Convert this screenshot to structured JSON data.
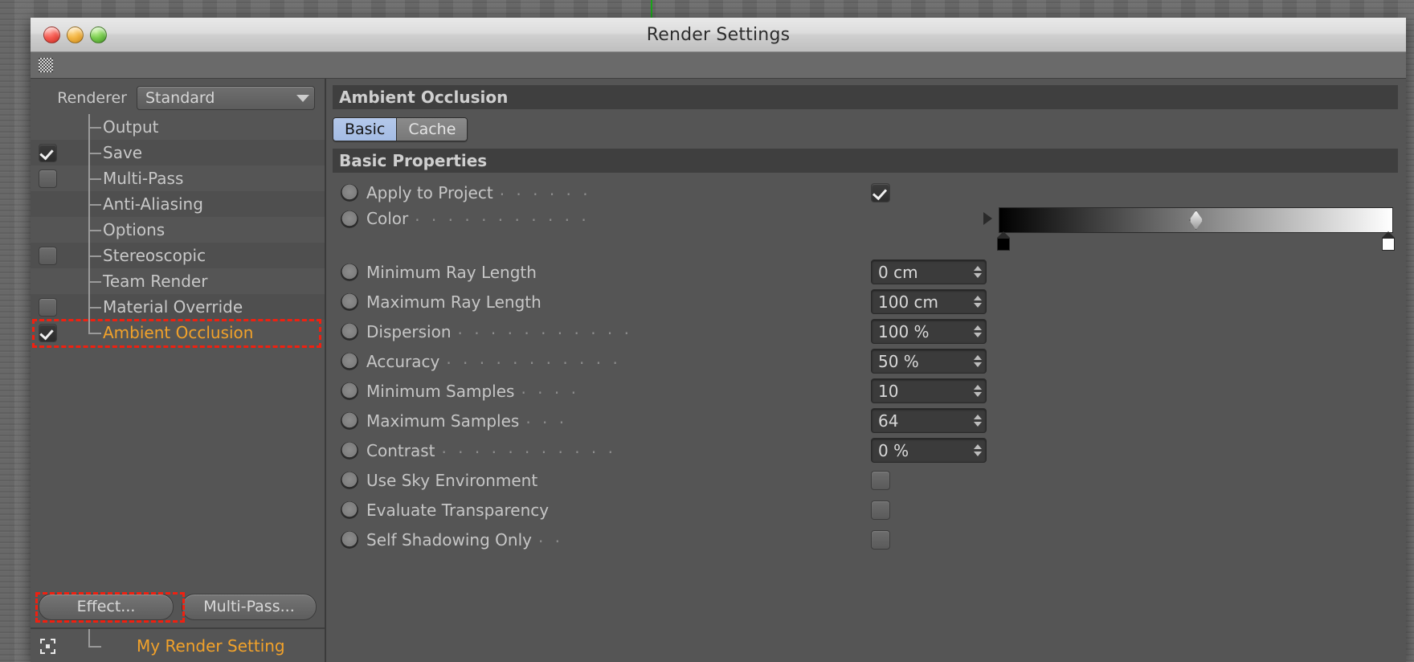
{
  "window": {
    "title": "Render Settings",
    "traffic_lights": [
      "close-button",
      "minimize-button",
      "zoom-button"
    ]
  },
  "toolbar": {
    "grip_icon": "grip-handle-icon"
  },
  "renderer": {
    "label": "Renderer",
    "selected": "Standard",
    "caret_icon": "chevron-down-icon"
  },
  "tree": {
    "items": [
      {
        "label": "Output",
        "checkbox": "none",
        "selected": false
      },
      {
        "label": "Save",
        "checkbox": "checked",
        "selected": false
      },
      {
        "label": "Multi-Pass",
        "checkbox": "unchecked",
        "selected": false
      },
      {
        "label": "Anti-Aliasing",
        "checkbox": "none",
        "selected": false
      },
      {
        "label": "Options",
        "checkbox": "none",
        "selected": false
      },
      {
        "label": "Stereoscopic",
        "checkbox": "unchecked",
        "selected": false
      },
      {
        "label": "Team Render",
        "checkbox": "none",
        "selected": false
      },
      {
        "label": "Material Override",
        "checkbox": "unchecked",
        "selected": false
      },
      {
        "label": "Ambient Occlusion",
        "checkbox": "checked",
        "selected": true
      }
    ]
  },
  "buttons": {
    "effect": "Effect...",
    "multipass": "Multi-Pass..."
  },
  "render_setting": {
    "name": "My Render Setting",
    "icon": "render-setting-icon"
  },
  "panel": {
    "title": "Ambient Occlusion",
    "tabs": [
      {
        "label": "Basic",
        "active": true
      },
      {
        "label": "Cache",
        "active": false
      }
    ],
    "group_header": "Basic Properties",
    "properties": [
      {
        "label": "Apply to Project",
        "dots": ". . . . . .",
        "control": "checkbox",
        "value": "checked"
      },
      {
        "label": "Color",
        "dots": ". . . . . . . . . . .",
        "control": "gradient",
        "value": ""
      },
      {
        "label": "Minimum Ray Length",
        "dots": "",
        "control": "number",
        "value": "0 cm"
      },
      {
        "label": "Maximum Ray Length",
        "dots": "",
        "control": "number",
        "value": "100 cm"
      },
      {
        "label": "Dispersion",
        "dots": ". . . . . . . . . . .",
        "control": "number",
        "value": "100 %"
      },
      {
        "label": "Accuracy",
        "dots": ". . . . . . . . . . .",
        "control": "number",
        "value": "50 %"
      },
      {
        "label": "Minimum Samples",
        "dots": ". . . .",
        "control": "number",
        "value": "10"
      },
      {
        "label": "Maximum Samples",
        "dots": ". . .",
        "control": "number",
        "value": "64"
      },
      {
        "label": "Contrast",
        "dots": ". . . . . . . . . . .",
        "control": "number",
        "value": "0 %"
      },
      {
        "label": "Use Sky Environment",
        "dots": "",
        "control": "checkbox",
        "value": "unchecked"
      },
      {
        "label": "Evaluate Transparency",
        "dots": "",
        "control": "checkbox",
        "value": "unchecked"
      },
      {
        "label": "Self Shadowing Only",
        "dots": ". .",
        "control": "checkbox",
        "value": "unchecked"
      }
    ],
    "gradient": {
      "start_color": "#000000",
      "end_color": "#ffffff",
      "interpolation_marker_position_pct": 50,
      "knobs": [
        {
          "position_pct": 0,
          "color": "#000000"
        },
        {
          "position_pct": 100,
          "color": "#ffffff"
        }
      ],
      "expand_icon": "triangle-right-icon"
    }
  },
  "annotations": {
    "highlight_color": "#f02010",
    "targets": [
      "ambient-occlusion-tree-row",
      "effect-button"
    ]
  }
}
